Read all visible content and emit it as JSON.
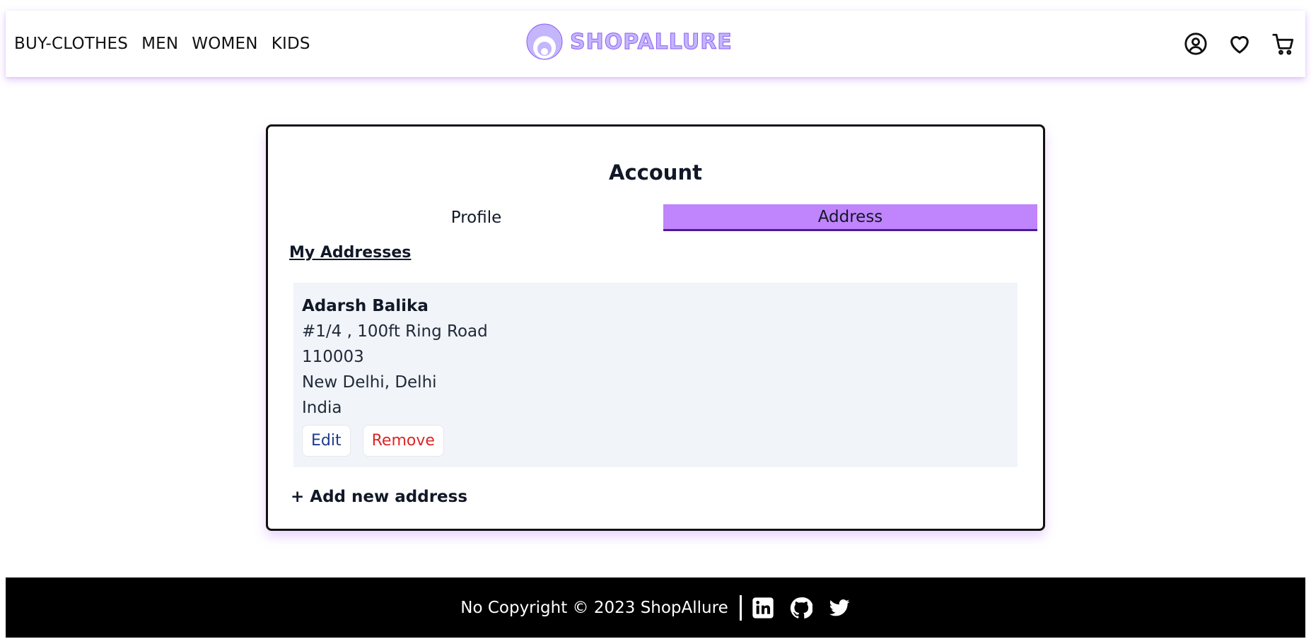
{
  "nav": {
    "links": [
      "BUY-CLOTHES",
      "MEN",
      "WOMEN",
      "KIDS"
    ],
    "brand": "SHOPALLURE",
    "icons": [
      "user-circle-icon",
      "heart-icon",
      "cart-icon"
    ]
  },
  "account": {
    "title": "Account",
    "tabs": [
      {
        "label": "Profile",
        "active": false
      },
      {
        "label": "Address",
        "active": true
      }
    ],
    "section_title": "My Addresses",
    "addresses": [
      {
        "name": "Adarsh Balika",
        "line1": "#1/4 , 100ft Ring Road",
        "pincode": "110003",
        "city_state": "New Delhi, Delhi",
        "country": "India",
        "edit_label": "Edit",
        "remove_label": "Remove"
      }
    ],
    "add_new_label": "+ Add new address"
  },
  "footer": {
    "text": "No Copyright © 2023 ShopAllure",
    "icons": [
      "linkedin-icon",
      "github-icon",
      "twitter-icon"
    ]
  },
  "colors": {
    "accent": "#c084fc",
    "brand": "#c4b5fd",
    "edit": "#1e3a8a",
    "remove": "#dc2626",
    "address_bg": "#f1f4f9"
  }
}
